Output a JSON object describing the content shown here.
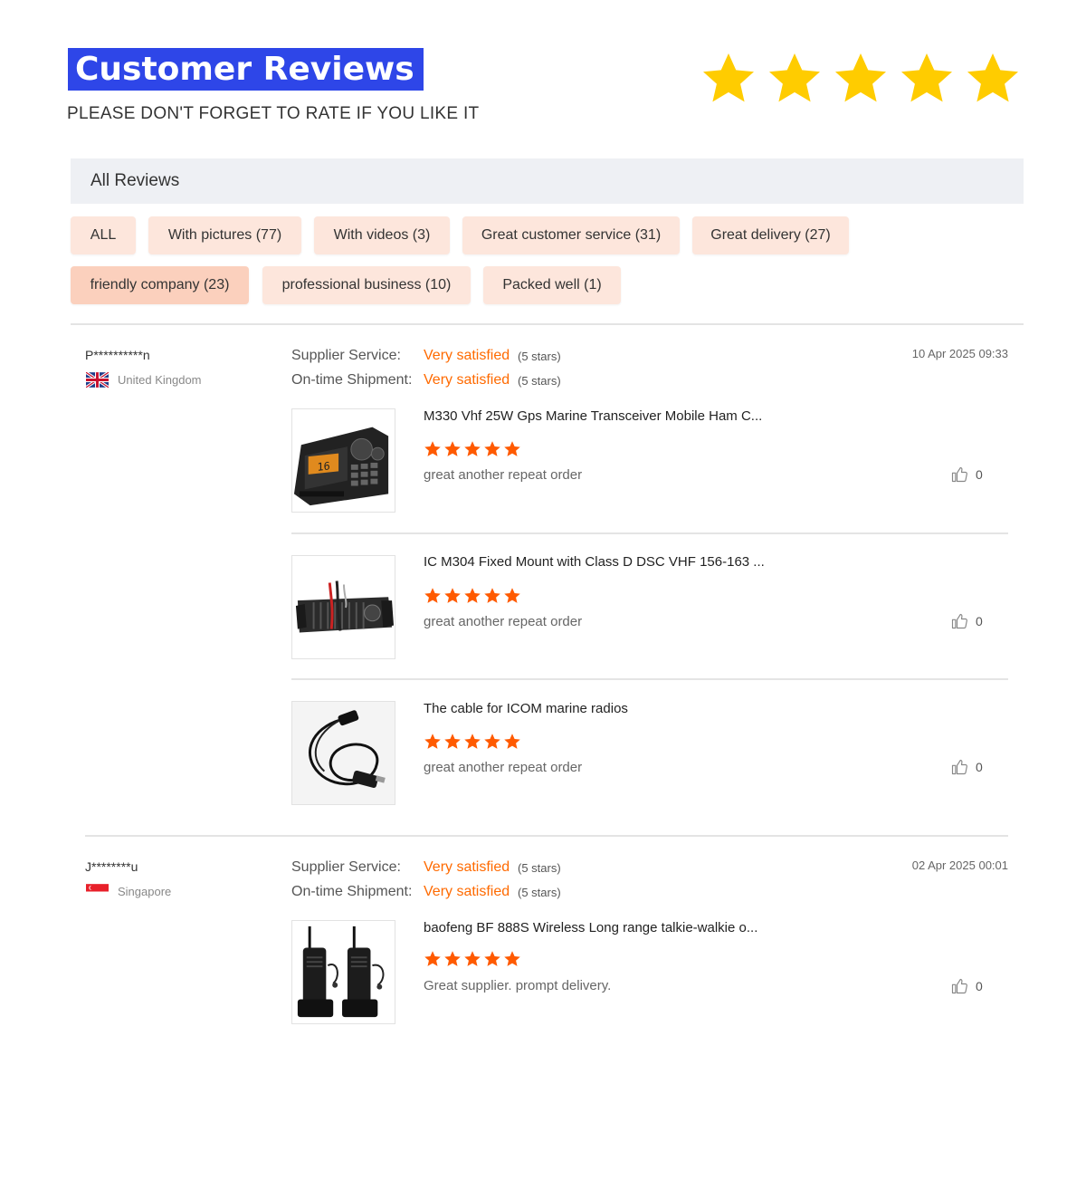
{
  "header": {
    "title": "Customer Reviews",
    "subtitle": "PLEASE DON'T FORGET TO RATE IF YOU LIKE IT",
    "big_star_count": 5,
    "star_color": "#ffcc00"
  },
  "panel": {
    "heading": "All Reviews",
    "filters": [
      {
        "label": "ALL"
      },
      {
        "label": "With pictures (77)"
      },
      {
        "label": "With videos (3)"
      },
      {
        "label": "Great customer service (31)"
      },
      {
        "label": "Great delivery (27)"
      },
      {
        "label": "friendly company (23)",
        "active": true
      },
      {
        "label": "professional business (10)"
      },
      {
        "label": "Packed well (1)"
      }
    ]
  },
  "colors": {
    "accent_orange": "#ff6a00",
    "title_blue": "#2e46e8",
    "filter_bg": "#fde6dc"
  },
  "reviews": [
    {
      "name": "P**********n",
      "country": "United Kingdom",
      "flag": "uk-flag-icon",
      "supplier_service_label": "Supplier Service:",
      "supplier_service_value": "Very satisfied",
      "supplier_service_stars": "(5 stars)",
      "shipment_label": "On-time Shipment:",
      "shipment_value": "Very satisfied",
      "shipment_stars": "(5 stars)",
      "date": "10 Apr 2025 09:33",
      "items": [
        {
          "title": "M330 Vhf 25W Gps Marine Transceiver Mobile Ham C...",
          "rating": 5,
          "comment": "great another repeat order",
          "likes": "0",
          "image": "marine-radio-image"
        },
        {
          "title": "IC M304 Fixed Mount with Class D DSC VHF 156-163 ...",
          "rating": 5,
          "comment": "great another repeat order",
          "likes": "0",
          "image": "mounted-radio-image"
        },
        {
          "title": "The cable for ICOM marine radios",
          "rating": 5,
          "comment": "great another repeat order",
          "likes": "0",
          "image": "cable-image"
        }
      ]
    },
    {
      "name": "J********u",
      "country": "Singapore",
      "flag": "singapore-flag-icon",
      "supplier_service_label": "Supplier Service:",
      "supplier_service_value": "Very satisfied",
      "supplier_service_stars": "(5 stars)",
      "shipment_label": "On-time Shipment:",
      "shipment_value": "Very satisfied",
      "shipment_stars": "(5 stars)",
      "date": "02 Apr 2025 00:01",
      "items": [
        {
          "title": "baofeng BF 888S Wireless Long range talkie-walkie o...",
          "rating": 5,
          "comment": "Great supplier. prompt delivery.",
          "likes": "0",
          "image": "walkie-talkie-image"
        }
      ]
    }
  ]
}
